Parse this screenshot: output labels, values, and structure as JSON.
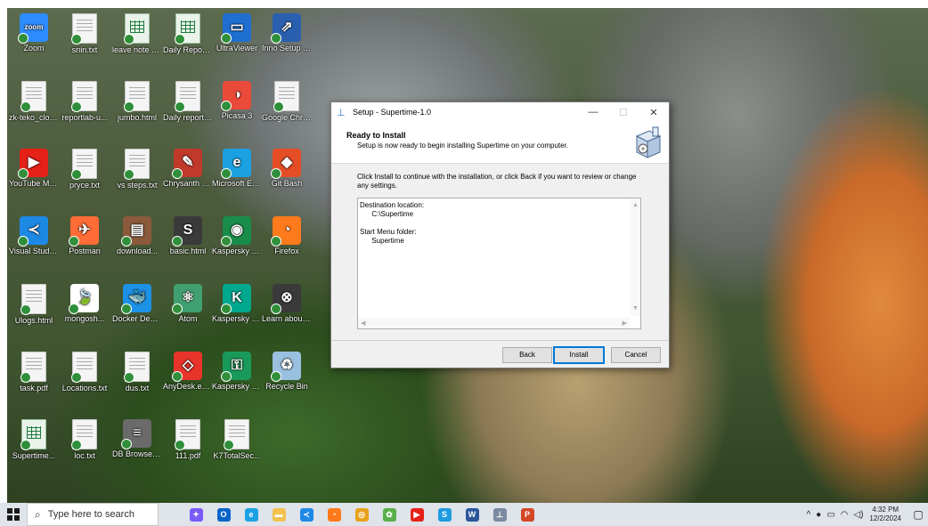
{
  "desktop": {
    "icons": [
      {
        "label": "Zoom",
        "color": "#2d8cff",
        "type": "app",
        "glyph": "zoom"
      },
      {
        "label": "snin.txt",
        "type": "doc"
      },
      {
        "label": "leave note supertime...",
        "type": "xls"
      },
      {
        "label": "Daily Reports Faraz.xlsx",
        "type": "xls"
      },
      {
        "label": "UltraViewer",
        "color": "#1f6fd1",
        "type": "app",
        "glyph": "▭"
      },
      {
        "label": "Inno Setup Compiler",
        "color": "#2a5fb0",
        "type": "app",
        "glyph": "⇗"
      },
      {
        "label": "zk-teko_clo... attendance...",
        "type": "doc"
      },
      {
        "label": "reportlab-u...",
        "type": "doc"
      },
      {
        "label": "jumbo.html",
        "type": "doc"
      },
      {
        "label": "Daily report - Faraz Ahm...",
        "type": "doc"
      },
      {
        "label": "Picasa 3",
        "color": "#e94a3a",
        "type": "app",
        "glyph": "◑"
      },
      {
        "label": "Google Chrome",
        "type": "doc"
      },
      {
        "label": "YouTube Music",
        "color": "#e62117",
        "type": "app",
        "glyph": "▶"
      },
      {
        "label": "pryce.txt",
        "type": "doc"
      },
      {
        "label": "vs steps.txt",
        "type": "doc"
      },
      {
        "label": "Chrysanth Cheque W...",
        "color": "#c0392b",
        "type": "app",
        "glyph": "✎"
      },
      {
        "label": "Microsoft Edge",
        "color": "#1ba1e2",
        "type": "app",
        "glyph": "e"
      },
      {
        "label": "Git Bash",
        "color": "#e44d26",
        "type": "app",
        "glyph": "◆"
      },
      {
        "label": "Visual Studio Code",
        "color": "#1e88e5",
        "type": "app",
        "glyph": "≺"
      },
      {
        "label": "Postman",
        "color": "#ff6c37",
        "type": "app",
        "glyph": "✈"
      },
      {
        "label": "download...",
        "color": "#8a5a3a",
        "type": "app",
        "glyph": "▤"
      },
      {
        "label": "basic.html",
        "color": "#3a3a3a",
        "type": "app",
        "glyph": "S"
      },
      {
        "label": "Kaspersky VPN",
        "color": "#1a8c4a",
        "type": "app",
        "glyph": "◉"
      },
      {
        "label": "Firefox",
        "color": "#ff7a1a",
        "type": "app",
        "glyph": "◔"
      },
      {
        "label": "Ulogs.html",
        "type": "doc"
      },
      {
        "label": "mongosh...",
        "color": "#ffffff",
        "type": "app",
        "glyph": "🍃"
      },
      {
        "label": "Docker Desktop",
        "color": "#1d91e6",
        "type": "app",
        "glyph": "🐳"
      },
      {
        "label": "Atom",
        "color": "#40a070",
        "type": "app",
        "glyph": "⚛"
      },
      {
        "label": "Kaspersky Small Offi...",
        "color": "#00a88e",
        "type": "app",
        "glyph": "K"
      },
      {
        "label": "Learn about this picture",
        "color": "#3a3a3a",
        "type": "app",
        "glyph": "⊗"
      },
      {
        "label": "task.pdf",
        "type": "doc"
      },
      {
        "label": "Locations.txt",
        "type": "doc"
      },
      {
        "label": "dus.txt",
        "type": "doc"
      },
      {
        "label": "AnyDesk.exe - Shortcut",
        "color": "#e8342a",
        "type": "app",
        "glyph": "◇"
      },
      {
        "label": "Kaspersky Passwor...",
        "color": "#1a9a5a",
        "type": "app",
        "glyph": "⚿"
      },
      {
        "label": "Recycle Bin",
        "color": "#9ac0e0",
        "type": "app",
        "glyph": "♻"
      },
      {
        "label": "Supertime...",
        "type": "xls"
      },
      {
        "label": "loc.txt",
        "type": "doc"
      },
      {
        "label": "DB Browser (SQLite)",
        "color": "#6a6a6a",
        "type": "app",
        "glyph": "≡"
      },
      {
        "label": "111.pdf",
        "type": "doc"
      },
      {
        "label": "K7TotalSec...",
        "type": "doc"
      }
    ]
  },
  "dialog": {
    "title": "Setup - Supertime-1.0",
    "min": "—",
    "max": "☐",
    "close": "✕",
    "heading": "Ready to Install",
    "subheading": "Setup is now ready to begin installing Supertime on your computer.",
    "intro": "Click Install to continue with the installation, or click Back if you want to review or change any settings.",
    "memo": "Destination location:\n      C:\\Supertime\n\nStart Menu folder:\n      Supertime",
    "buttons": {
      "back": "Back",
      "install": "Install",
      "cancel": "Cancel"
    }
  },
  "taskbar": {
    "search_placeholder": "Type here to search",
    "time": "4:32 PM",
    "date": "12/2/2024",
    "apps": [
      {
        "name": "copilot",
        "color": "#7a5af8",
        "glyph": "✦"
      },
      {
        "name": "outlook",
        "color": "#0a64c8",
        "glyph": "O"
      },
      {
        "name": "edge",
        "color": "#1ba1e2",
        "glyph": "e"
      },
      {
        "name": "file-explorer",
        "color": "#f2c14e",
        "glyph": "▬"
      },
      {
        "name": "vscode",
        "color": "#1e88e5",
        "glyph": "≺"
      },
      {
        "name": "firefox",
        "color": "#ff7a1a",
        "glyph": "◔"
      },
      {
        "name": "chrome",
        "color": "#e8a21a",
        "glyph": "◎"
      },
      {
        "name": "photos",
        "color": "#5ab04a",
        "glyph": "✿"
      },
      {
        "name": "youtube-music",
        "color": "#e62117",
        "glyph": "▶"
      },
      {
        "name": "skype",
        "color": "#1e9be0",
        "glyph": "S"
      },
      {
        "name": "word",
        "color": "#2b579a",
        "glyph": "W"
      },
      {
        "name": "setup",
        "color": "#7a8aa0",
        "glyph": "⊥"
      },
      {
        "name": "powerpoint",
        "color": "#d24726",
        "glyph": "P"
      }
    ]
  }
}
